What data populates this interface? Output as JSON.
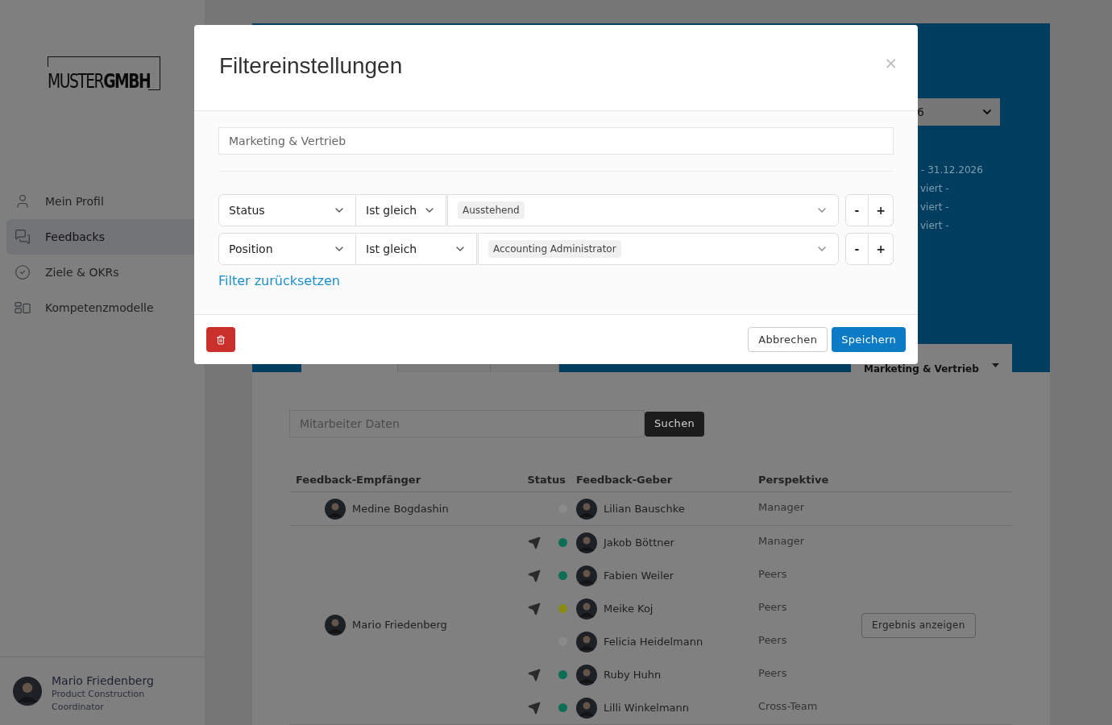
{
  "sidebar": {
    "logo": "MUSTER**GMBH**",
    "items": [
      {
        "label": "Mein Profil",
        "kind": "user",
        "selected": false
      },
      {
        "label": "Feedbacks",
        "kind": "messages",
        "selected": true
      },
      {
        "label": "Ziele & OKRs",
        "kind": "check",
        "selected": false
      },
      {
        "label": "Kompetenzmodelle",
        "kind": "models",
        "selected": false
      }
    ],
    "user": {
      "name": "Mario Friedenberg",
      "title": "Product Construction Coordinator"
    }
  },
  "header": {
    "period_select": "6",
    "period": "- 31.12.2026",
    "notes": [
      "viert -",
      "viert -",
      "viert -"
    ],
    "tabs": [
      {
        "selected": true
      },
      {
        "selected": false
      },
      {
        "selected": false
      }
    ],
    "department": "Marketing & Vertrieb"
  },
  "search": {
    "placeholder": "Mitarbeiter Daten",
    "button": "Suchen"
  },
  "table": {
    "columns": [
      "Feedback-Empfänger",
      "Status",
      "Feedback-Geber",
      "Perspektive"
    ],
    "groups": [
      {
        "recipient": "Medine Bogdashin",
        "givers": [
          {
            "sent": false,
            "color": "#8a8a8a",
            "name": "Lilian Bauschke",
            "perspective": "Manager"
          }
        ]
      },
      {
        "recipient": "Mario Friedenberg",
        "action": "Ergebnis anzeigen",
        "givers": [
          {
            "sent": true,
            "color": "#0e6e55",
            "name": "Jakob Böttner",
            "perspective": "Manager"
          },
          {
            "sent": true,
            "color": "#0e6e55",
            "name": "Fabien Weiler",
            "perspective": "Peers"
          },
          {
            "sent": true,
            "color": "#8a8a14",
            "name": "Meike Koj",
            "perspective": "Peers"
          },
          {
            "sent": false,
            "color": "#8a8a8a",
            "name": "Felicia Heidelmann",
            "perspective": "Peers"
          },
          {
            "sent": true,
            "color": "#0e6e55",
            "name": "Ruby Huhn",
            "perspective": "Peers"
          },
          {
            "sent": true,
            "color": "#0e6e55",
            "name": "Lilli Winkelmann",
            "perspective": "Cross-Team"
          }
        ]
      }
    ]
  },
  "modal": {
    "title": "Filtereinstellungen",
    "close": "×",
    "group": "Marketing & Vertrieb",
    "filters": [
      {
        "field": "Status",
        "operator": "Ist gleich",
        "values": [
          "Ausstehend"
        ],
        "remove": "-",
        "add": "+"
      },
      {
        "field": "Position",
        "operator": "Ist gleich",
        "values": [
          "Accounting Administrator"
        ],
        "remove": "-",
        "add": "+"
      }
    ],
    "reset": "Filter zurücksetzen",
    "cancel": "Abbrechen",
    "save": "Speichern"
  }
}
